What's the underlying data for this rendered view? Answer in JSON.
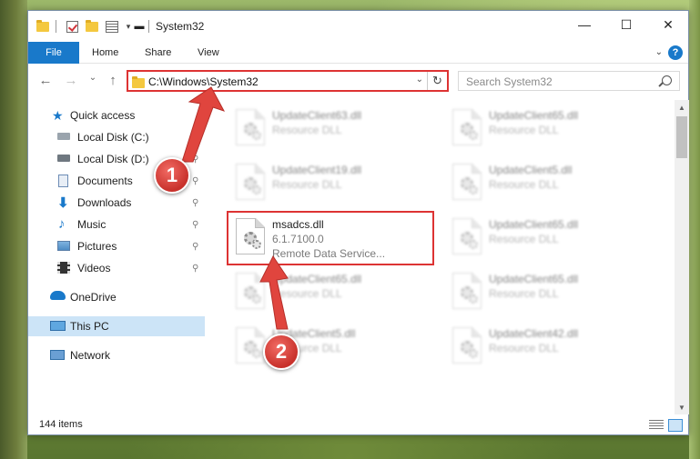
{
  "titlebar": {
    "title": "System32",
    "minimize": "—",
    "maximize": "☐",
    "close": "✕"
  },
  "ribbon": {
    "tabs": [
      "File",
      "Home",
      "Share",
      "View"
    ],
    "collapse_glyph": "⌄",
    "help_glyph": "?"
  },
  "navigation": {
    "back": "←",
    "forward": "→",
    "recent": "⌄",
    "up": "↑",
    "address": "C:\\Windows\\System32",
    "address_dropdown": "⌄",
    "refresh": "↻",
    "search_placeholder": "Search System32"
  },
  "sidebar": {
    "items": [
      {
        "label": "Quick access",
        "icon": "star-icon"
      },
      {
        "label": "Local Disk (C:)",
        "icon": "drive-icon",
        "pinned": true
      },
      {
        "label": "Local Disk (D:)",
        "icon": "drive-icon",
        "pinned": true
      },
      {
        "label": "Documents",
        "icon": "documents-icon",
        "pinned": true
      },
      {
        "label": "Downloads",
        "icon": "download-icon",
        "pinned": true
      },
      {
        "label": "Music",
        "icon": "music-icon",
        "pinned": true
      },
      {
        "label": "Pictures",
        "icon": "pictures-icon",
        "pinned": true
      },
      {
        "label": "Videos",
        "icon": "videos-icon",
        "pinned": true
      },
      {
        "label": "OneDrive",
        "icon": "cloud-icon"
      },
      {
        "label": "This PC",
        "icon": "computer-icon",
        "selected": true
      },
      {
        "label": "Network",
        "icon": "network-icon"
      }
    ],
    "pin_glyph": "📌"
  },
  "files": {
    "left": [
      {
        "name": "UpdateClient63.dll",
        "type": "Resource DLL"
      },
      {
        "name": "UpdateClient19.dll",
        "type": "Resource DLL"
      },
      {
        "name": "msadcs.dll",
        "version": "6.1.7100.0",
        "type": "Remote Data Service..."
      },
      {
        "name": "UpdateClient65.dll",
        "type": "Resource DLL"
      },
      {
        "name": "UpdateClient5.dll",
        "type": "Resource DLL"
      }
    ],
    "right": [
      {
        "name": "UpdateClient65.dll",
        "type": "Resource DLL"
      },
      {
        "name": "UpdateClient5.dll",
        "type": "Resource DLL"
      },
      {
        "name": "UpdateClient65.dll",
        "type": "Resource DLL"
      },
      {
        "name": "UpdateClient65.dll",
        "type": "Resource DLL"
      },
      {
        "name": "UpdateClient42.dll",
        "type": "Resource DLL"
      }
    ]
  },
  "status": {
    "item_count": "144 items"
  },
  "annotations": {
    "step1": "1",
    "step2": "2"
  },
  "colors": {
    "accent": "#1979ca",
    "highlight_border": "#dd3333",
    "callout": "#c8312b",
    "selected_bg": "#cce4f7"
  }
}
